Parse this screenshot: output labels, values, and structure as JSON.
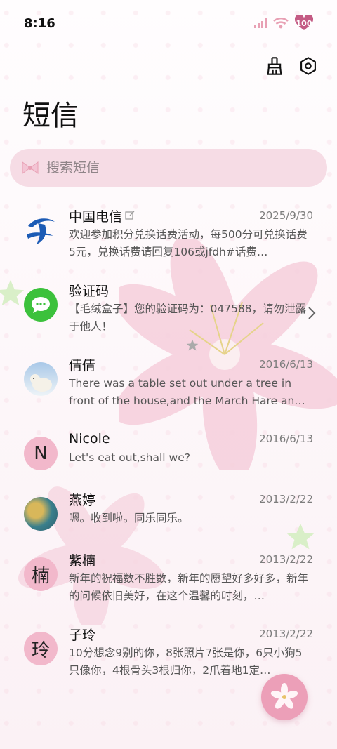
{
  "status_bar": {
    "time": "8:16",
    "battery": "100"
  },
  "page_title": "短信",
  "search": {
    "placeholder": "搜索短信"
  },
  "messages": [
    {
      "name": "中国电信",
      "date": "2025/9/30",
      "preview": "欢迎参加积分兑换话费活动，每500分可兑换话费5元，兑换话费请回复106或jfdh#话费…",
      "avatar": "china-telecom-logo"
    },
    {
      "name": "验证码",
      "date": "",
      "preview": "【毛绒盒子】您的验证码为：047588，请勿泄露于他人！",
      "avatar": "message-bubble-icon"
    },
    {
      "name": "倩倩",
      "date": "2016/6/13",
      "preview": "There was a table set out under a tree in front of the house,and the March Hare an…",
      "avatar": "polar-bear-photo"
    },
    {
      "name": "Nicole",
      "date": "2016/6/13",
      "preview": "Let's eat out,shall we?",
      "avatar": "N"
    },
    {
      "name": "燕婷",
      "date": "2013/2/22",
      "preview": "嗯。收到啦。同乐同乐。",
      "avatar": "landscape-photo"
    },
    {
      "name": "紫楠",
      "date": "2013/2/22",
      "preview": "新年的祝福数不胜数，新年的愿望好多好多，新年的问候依旧美好，在这个温馨的时刻，…",
      "avatar": "楠"
    },
    {
      "name": "子玲",
      "date": "2013/2/22",
      "preview": "10分想念9别的你，8张照片7张是你，6只小狗5只像你，4根骨头3根归你，2爪着地1定…",
      "avatar": "玲"
    }
  ],
  "colors": {
    "accent_pink": "#ec9fb8",
    "search_bg": "#f6dce5",
    "letter_avatar": "#f2b8cb",
    "telecom_blue": "#1c5bb5",
    "wechat_green": "#3cc13c"
  }
}
